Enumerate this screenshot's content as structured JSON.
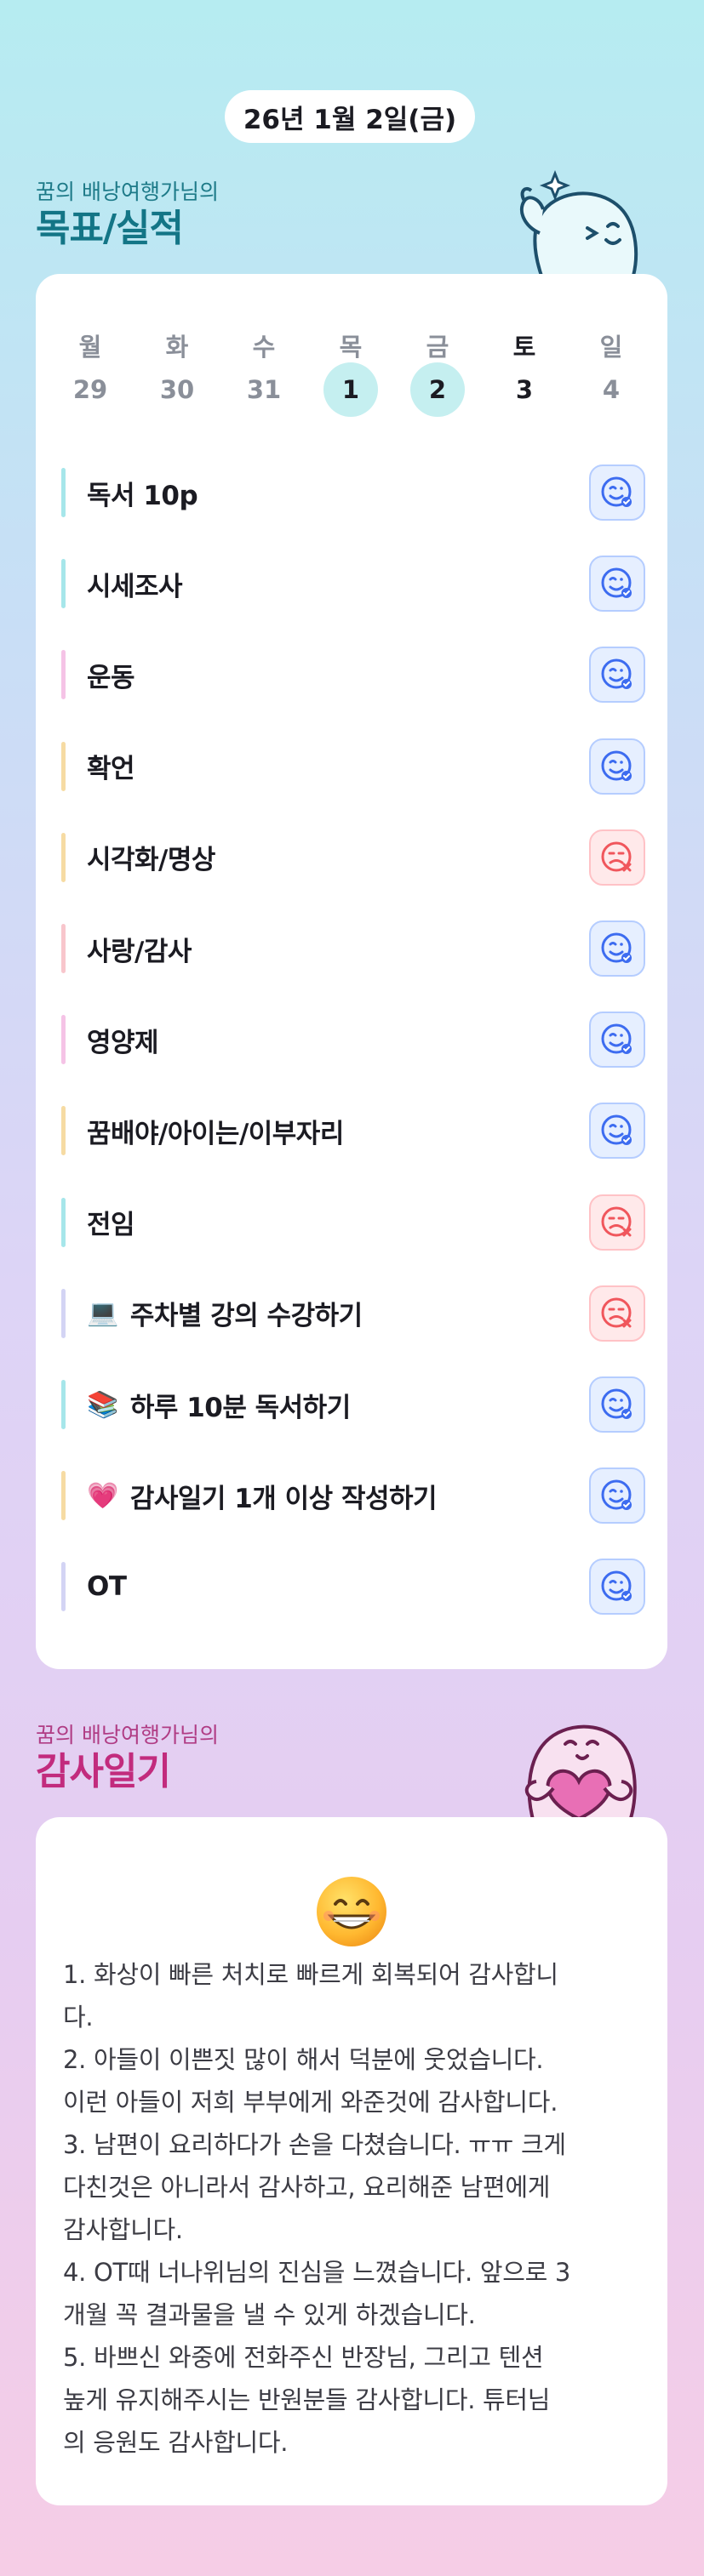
{
  "header": {
    "date": "26년 1월 2일(금)"
  },
  "goals_section": {
    "subtitle": "꿈의 배낭여행가님의",
    "title": "목표/실적"
  },
  "calendar": {
    "days": [
      "월",
      "화",
      "수",
      "목",
      "금",
      "토",
      "일"
    ],
    "dates": [
      "29",
      "30",
      "31",
      "1",
      "2",
      "3",
      "4"
    ],
    "completed_dates": [
      "1",
      "2"
    ]
  },
  "goals": [
    {
      "label": "독서 10p",
      "emoji": "",
      "status": "success",
      "bar_color": "#a6e6ea"
    },
    {
      "label": "시세조사",
      "emoji": "",
      "status": "success",
      "bar_color": "#a6e6ea"
    },
    {
      "label": "운동",
      "emoji": "",
      "status": "success",
      "bar_color": "#f5c3e6"
    },
    {
      "label": "확언",
      "emoji": "",
      "status": "success",
      "bar_color": "#f6dba3"
    },
    {
      "label": "시각화/명상",
      "emoji": "",
      "status": "fail",
      "bar_color": "#f6dba3"
    },
    {
      "label": "사랑/감사",
      "emoji": "",
      "status": "success",
      "bar_color": "#f8c6cc"
    },
    {
      "label": "영양제",
      "emoji": "",
      "status": "success",
      "bar_color": "#f5c3e6"
    },
    {
      "label": "꿈배야/아이는/이부자리",
      "emoji": "",
      "status": "success",
      "bar_color": "#f6dba3"
    },
    {
      "label": "전임",
      "emoji": "",
      "status": "fail",
      "bar_color": "#a6e6ea"
    },
    {
      "label": "주차별 강의 수강하기",
      "emoji": "💻",
      "status": "fail",
      "bar_color": "#d3d4f4"
    },
    {
      "label": "하루 10분 독서하기",
      "emoji": "📚",
      "status": "success",
      "bar_color": "#a6e6ea"
    },
    {
      "label": "감사일기 1개 이상 작성하기",
      "emoji": "💗",
      "status": "success",
      "bar_color": "#f6dba3"
    },
    {
      "label": "OT",
      "emoji": "",
      "status": "success",
      "bar_color": "#d3d4f4"
    }
  ],
  "gratitude_section": {
    "subtitle": "꿈의 배낭여행가님의",
    "title": "감사일기"
  },
  "gratitude": {
    "emoji": "😁",
    "lines": [
      "1. 화상이 빠른 처치로 빠르게 회복되어 감사합니",
      "다.",
      "2. 아들이 이쁜짓 많이 해서 덕분에 웃었습니다.",
      "이런 아들이 저희 부부에게 와준것에 감사합니다.",
      "3. 남편이 요리하다가 손을 다쳤습니다. ㅠㅠ 크게",
      "다친것은 아니라서 감사하고, 요리해준 남편에게",
      "감사합니다.",
      "4. OT때 너나위님의 진심을 느꼈습니다. 앞으로 3",
      "개월 꼭 결과물을 낼 수 있게 하겠습니다.",
      "5. 바쁘신 와중에 전화주신 반장님, 그리고 텐션",
      "높게 유지해주시는 반원분들 감사합니다. 튜터님",
      "의 응원도 감사합니다."
    ]
  },
  "colors": {
    "teal_title": "#137586",
    "pink_title": "#c22b7d",
    "success": "#3d6cf0",
    "fail": "#f0565c",
    "done_circle": "#c5eff0"
  }
}
